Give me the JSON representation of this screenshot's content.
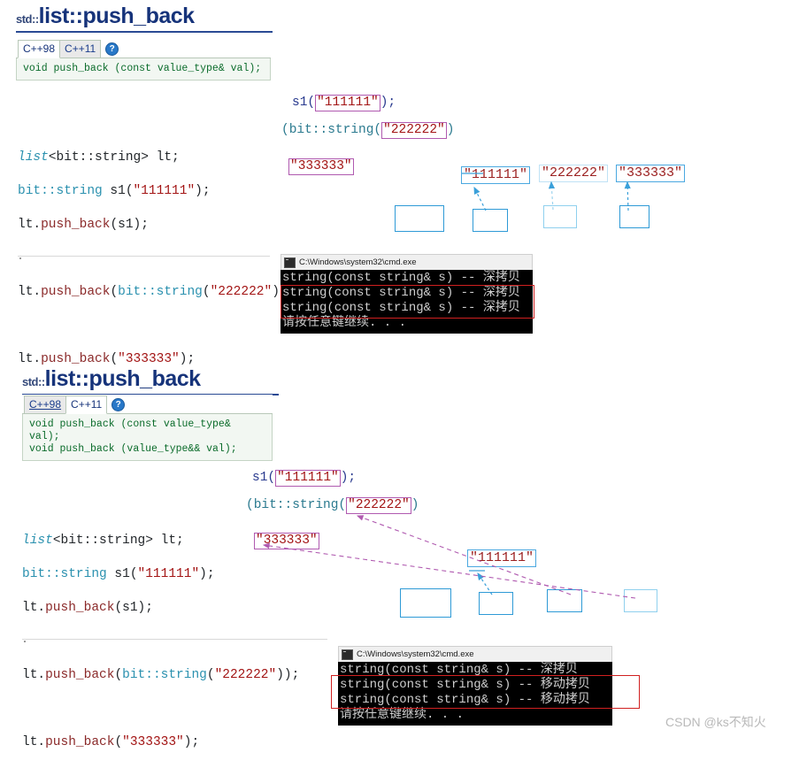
{
  "watermark": "CSDN @ks不知火",
  "sections": [
    {
      "id": "section-1",
      "reference": {
        "namespace": "std::",
        "name": "list::push_back",
        "tabs": [
          {
            "label": "C++98",
            "state": "active"
          },
          {
            "label": "C++11",
            "state": "inactive"
          }
        ],
        "help_icon": "?",
        "signatures": [
          "void push_back (const value_type& val);"
        ]
      },
      "code_lines": [
        "list<bit::string> lt;",
        "bit::string s1(\"111111\");",
        "lt.push_back(s1);",
        "",
        "lt.push_back(bit::string(\"222222\"));",
        "",
        "lt.push_back(\"333333\");"
      ],
      "annotations": {
        "purple_call_1": "s1(\"111111\");",
        "purple_call_1_boxed": "\"111111\"",
        "purple_call_2_prefix": "(bit::string(",
        "purple_call_2_boxed": "\"222222\"",
        "purple_call_2_suffix": ")",
        "purple_call_3_boxed": "\"333333\"",
        "blue_labels": [
          "\"111111\"",
          "\"222222\"",
          "\"333333\""
        ]
      },
      "console": {
        "title": "C:\\Windows\\system32\\cmd.exe",
        "lines": [
          "string(const string& s) -- 深拷贝",
          "string(const string& s) -- 深拷贝",
          "string(const string& s) -- 深拷贝",
          "请按任意键继续. . ."
        ],
        "highlight_color": "#d02020"
      }
    },
    {
      "id": "section-2",
      "reference": {
        "namespace": "std::",
        "name": "list::push_back",
        "tabs": [
          {
            "label": "C++98",
            "state": "link"
          },
          {
            "label": "C++11",
            "state": "active"
          }
        ],
        "help_icon": "?",
        "signatures": [
          "void push_back (const value_type& val);",
          "void push_back (value_type&& val);"
        ]
      },
      "code_lines": [
        "list<bit::string> lt;",
        "bit::string s1(\"111111\");",
        "lt.push_back(s1);",
        "",
        "lt.push_back(bit::string(\"222222\"));",
        "",
        "lt.push_back(\"333333\");"
      ],
      "annotations": {
        "purple_call_1": "s1(\"111111\");",
        "purple_call_1_boxed": "\"111111\"",
        "purple_call_2_prefix": "(bit::string(",
        "purple_call_2_boxed": "\"222222\"",
        "purple_call_2_suffix": ")",
        "purple_call_3_boxed": "\"333333\"",
        "blue_labels": [
          "\"111111\""
        ]
      },
      "console": {
        "title": "C:\\Windows\\system32\\cmd.exe",
        "lines": [
          "string(const string& s) -- 深拷贝",
          "string(const string& s) -- 移动拷贝",
          "string(const string& s) -- 移动拷贝",
          "请按任意键继续. . ."
        ],
        "highlight_color": "#d02020"
      }
    }
  ]
}
